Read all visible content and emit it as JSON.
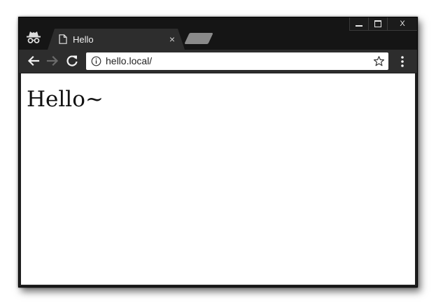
{
  "browser": {
    "tab": {
      "title": "Hello",
      "close_glyph": "×"
    },
    "window_controls": {
      "close_glyph": "X"
    },
    "address_bar": {
      "url": "hello.local/"
    },
    "icons": {
      "incognito": "incognito-icon",
      "page": "document-icon",
      "back": "back-arrow-icon",
      "forward": "forward-arrow-icon",
      "reload": "reload-icon",
      "info": "info-icon",
      "bookmark": "star-icon",
      "menu": "kebab-menu-icon"
    },
    "colors": {
      "frame": "#151515",
      "toolbar": "#2d2d2d",
      "tab_text": "#f0f0f0"
    }
  },
  "page": {
    "heading": "Hello~"
  }
}
